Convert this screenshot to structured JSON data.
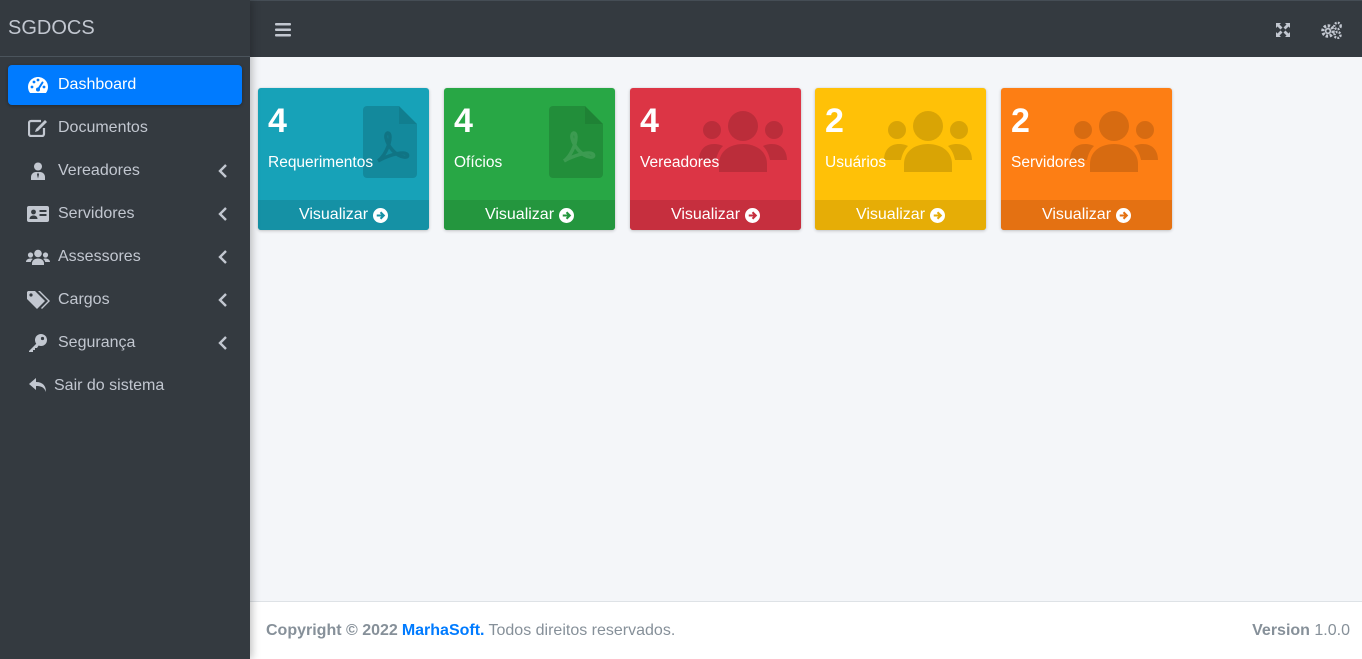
{
  "app": {
    "brand": "SGDOCS"
  },
  "sidebar": {
    "items": [
      {
        "label": "Dashboard",
        "icon": "dashboard-icon",
        "active": true
      },
      {
        "label": "Documentos",
        "icon": "edit-icon"
      },
      {
        "label": "Vereadores",
        "icon": "user-tie-icon"
      },
      {
        "label": "Servidores",
        "icon": "id-card-icon"
      },
      {
        "label": "Assessores",
        "icon": "users-icon"
      },
      {
        "label": "Cargos",
        "icon": "tags-icon"
      },
      {
        "label": "Segurança",
        "icon": "key-icon"
      },
      {
        "label": "Sair do sistema",
        "icon": "reply-icon"
      }
    ]
  },
  "topbar": {
    "menu_icon": "hamburger-icon",
    "fullscreen_icon": "expand-icon",
    "settings_icon": "cogs-icon"
  },
  "cards": [
    {
      "count": "4",
      "label": "Requerimentos",
      "link": "Visualizar",
      "color": "#17a2b8",
      "footer_color": "#1591a5",
      "icon": "file-pdf-icon"
    },
    {
      "count": "4",
      "label": "Ofícios",
      "link": "Visualizar",
      "color": "#28a745",
      "footer_color": "#24963e",
      "icon": "file-pdf-icon"
    },
    {
      "count": "4",
      "label": "Vereadores",
      "link": "Visualizar",
      "color": "#dc3545",
      "footer_color": "#c62f3e",
      "icon": "users-icon"
    },
    {
      "count": "2",
      "label": "Usuários",
      "link": "Visualizar",
      "color": "#ffc107",
      "footer_color": "#e6ad06",
      "icon": "users-icon"
    },
    {
      "count": "2",
      "label": "Servidores",
      "link": "Visualizar",
      "color": "#fd7e14",
      "footer_color": "#e47112",
      "icon": "users-icon"
    }
  ],
  "footer": {
    "copyright": "Copyright © 2022",
    "company": "MarhaSoft.",
    "rights": "Todos direitos reservados.",
    "version_label": "Version",
    "version": "1.0.0"
  }
}
